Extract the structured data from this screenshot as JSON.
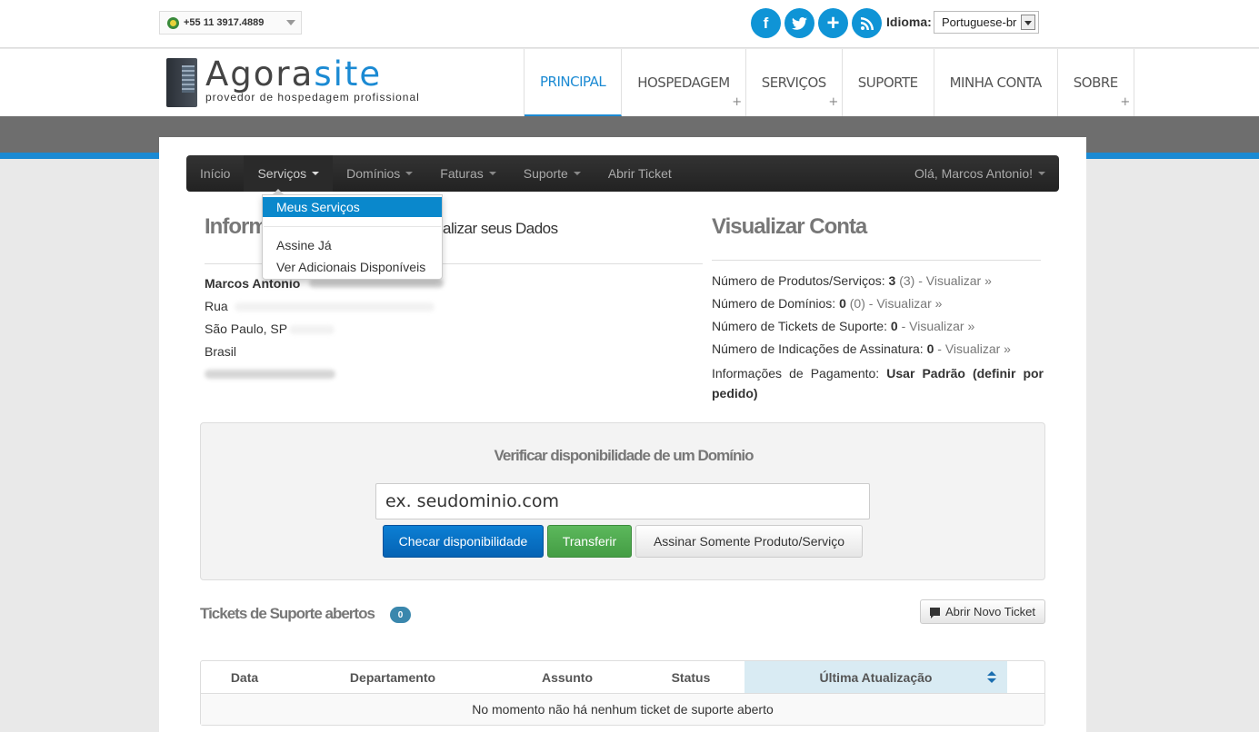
{
  "topbar": {
    "phone": "+55 11 3917.4889",
    "social": [
      {
        "name": "facebook-icon",
        "glyph": "f"
      },
      {
        "name": "twitter-icon",
        "glyph": "t"
      },
      {
        "name": "plus-icon",
        "glyph": "+"
      },
      {
        "name": "rss-icon",
        "glyph": "r"
      }
    ],
    "idioma_label": "Idioma:",
    "idioma_value": "Portuguese-br"
  },
  "header": {
    "logo_main": "Agora",
    "logo_accent": "site",
    "logo_sub": "provedor de hospedagem profissional",
    "nav": [
      {
        "label": "PRINCIPAL",
        "active": true,
        "plus": false
      },
      {
        "label": "HOSPEDAGEM",
        "active": false,
        "plus": true
      },
      {
        "label": "SERVIÇOS",
        "active": false,
        "plus": true
      },
      {
        "label": "SUPORTE",
        "active": false,
        "plus": false
      },
      {
        "label": "MINHA CONTA",
        "active": false,
        "plus": false
      },
      {
        "label": "SOBRE",
        "active": false,
        "plus": true
      }
    ]
  },
  "subnav": {
    "items": [
      "Início",
      "Serviços",
      "Domínios",
      "Faturas",
      "Suporte",
      "Abrir Ticket"
    ],
    "user": "Olá, Marcos Antonio!"
  },
  "dropdown": {
    "items": [
      "Meus Serviços",
      "Assine Já",
      "Ver Adicionais Disponíveis"
    ]
  },
  "info": {
    "title": "Inform",
    "subtitle": "alizar seus Dados",
    "name": "Marcos Antonio",
    "street": "Rua",
    "city": "São Paulo, SP",
    "country": "Brasil"
  },
  "conta": {
    "title": "Visualizar Conta",
    "stats": [
      {
        "label": "Número de Produtos/Serviços:",
        "value": "3",
        "extra": "(3)",
        "link": "- Visualizar »"
      },
      {
        "label": "Número de Domínios:",
        "value": "0",
        "extra": "(0)",
        "link": "- Visualizar »"
      },
      {
        "label": "Número de Tickets de Suporte:",
        "value": "0",
        "extra": "",
        "link": "- Visualizar »"
      },
      {
        "label": "Número de Indicações de Assinatura:",
        "value": "0",
        "extra": "",
        "link": "- Visualizar »"
      }
    ],
    "pay_label": "Informações de Pagamento:",
    "pay_value": "Usar Padrão (definir por pedido)"
  },
  "domain": {
    "title": "Verificar disponibilidade de um Domínio",
    "placeholder": "ex. seudominio.com",
    "btn_check": "Checar disponibilidade",
    "btn_transfer": "Transferir",
    "btn_only": "Assinar Somente Produto/Serviço"
  },
  "tickets": {
    "title": "Tickets de Suporte abertos",
    "count": "0",
    "new_ticket": "Abrir Novo Ticket",
    "columns": [
      "Data",
      "Departamento",
      "Assunto",
      "Status",
      "Última Atualização"
    ],
    "empty": "No momento não há nenhum ticket de suporte aberto"
  },
  "colors": {
    "accent": "#1b8ad3",
    "social": "#0f94d6",
    "primary_button": "#0563b4",
    "success_button": "#5cb85c",
    "badge": "#3a87ad"
  }
}
